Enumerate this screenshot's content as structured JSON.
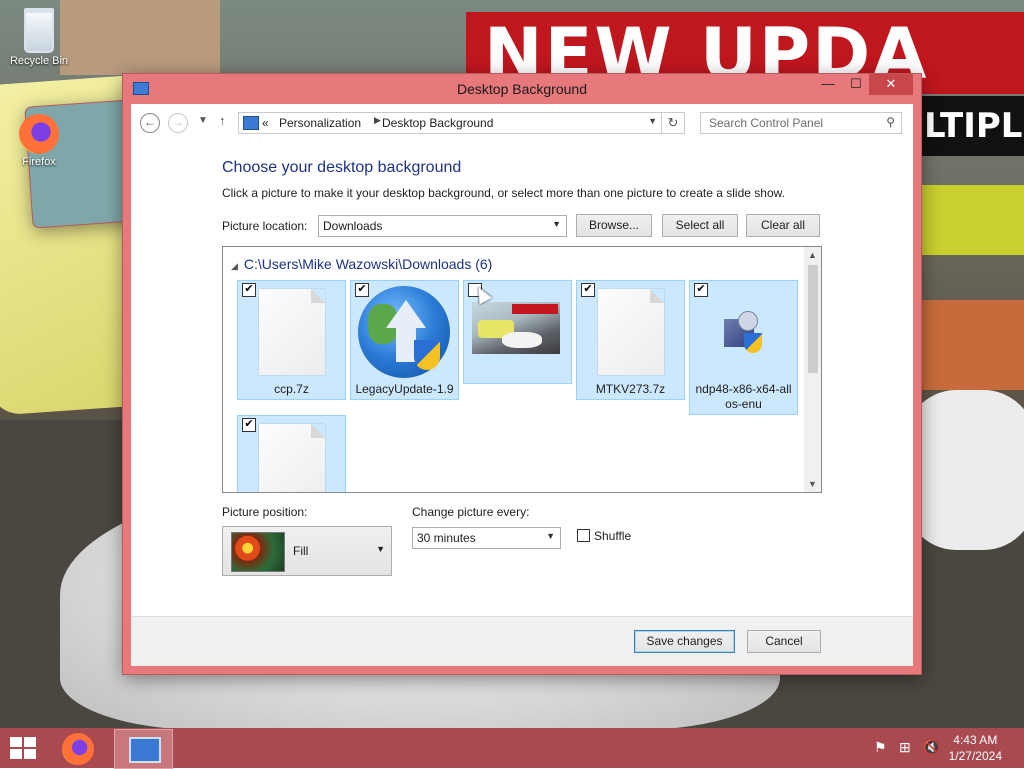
{
  "desktop": {
    "icons": [
      {
        "label": "Recycle Bin",
        "icon": "recycle-bin-icon"
      },
      {
        "label": "Firefox",
        "icon": "firefox-icon"
      }
    ],
    "wallpaper": {
      "banner_line1": "NEW UPDA",
      "banner_line2": "LTIPL"
    }
  },
  "window": {
    "title": "Desktop Background",
    "controls": {
      "minimize": "—",
      "maximize": "☐",
      "close": "✕"
    }
  },
  "address_bar": {
    "prefix": "«",
    "breadcrumbs": [
      "Personalization",
      "Desktop Background"
    ],
    "separator": "▶",
    "search_placeholder": "Search Control Panel"
  },
  "content": {
    "heading": "Choose your desktop background",
    "description": "Click a picture to make it your desktop background, or select more than one picture to create a slide show.",
    "picture_location_label": "Picture location:",
    "picture_location_value": "Downloads",
    "browse_label": "Browse...",
    "select_all_label": "Select all",
    "clear_all_label": "Clear all",
    "group_header": "C:\\Users\\Mike Wazowski\\Downloads (6)",
    "items": [
      {
        "name": "ccp.7z",
        "checked": true,
        "type": "file"
      },
      {
        "name": "LegacyUpdate-1.9",
        "checked": true,
        "type": "globe"
      },
      {
        "name": "",
        "checked": false,
        "type": "picture"
      },
      {
        "name": "MTKV273.7z",
        "checked": true,
        "type": "file"
      },
      {
        "name": "ndp48-x86-x64-allos-enu",
        "name_line1": "ndp48-x86-x64-all",
        "name_line2": "os-enu",
        "checked": true,
        "type": "installer"
      },
      {
        "name": "",
        "checked": true,
        "type": "file"
      }
    ],
    "check_mark": "✔",
    "picture_position_label": "Picture position:",
    "picture_position_value": "Fill",
    "change_picture_label": "Change picture every:",
    "change_picture_value": "30 minutes",
    "shuffle_label": "Shuffle",
    "shuffle_checked": false
  },
  "footer": {
    "save_label": "Save changes",
    "cancel_label": "Cancel"
  },
  "taskbar": {
    "time": "4:43 AM",
    "date": "1/27/2024"
  }
}
